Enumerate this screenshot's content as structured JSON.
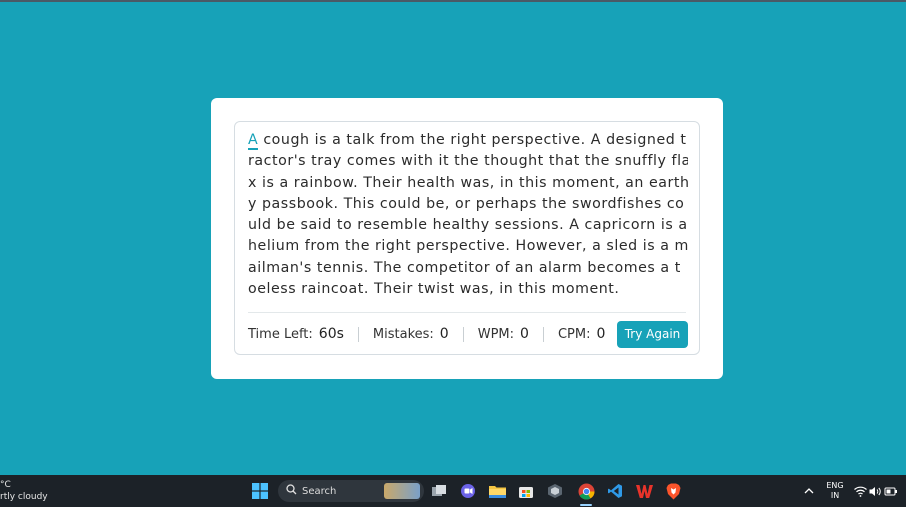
{
  "typing": {
    "active_char": "A",
    "first_line_rest": " cough is a talk from the right perspective. A designed t",
    "lines": [
      "ractor's tray comes with it the thought that the snuffly fla",
      "x is a rainbow. Their health was, in this moment, an earth",
      "y passbook. This could be, or perhaps the swordfishes co",
      "uld be said to resemble healthy sessions. A capricorn is a",
      "helium from the right perspective. However, a sled is a m",
      "ailman's tennis. The competitor of an alarm becomes a t",
      "oeless raincoat. Their twist was, in this moment."
    ]
  },
  "stats": {
    "time_label": "Time Left:",
    "time_value": "60s",
    "mistakes_label": "Mistakes:",
    "mistakes_value": "0",
    "wpm_label": "WPM:",
    "wpm_value": "0",
    "cpm_label": "CPM:",
    "cpm_value": "0"
  },
  "buttons": {
    "try_again": "Try Again"
  },
  "taskbar": {
    "weather_temp": "°C",
    "weather_desc": "rtly cloudy",
    "search_label": "Search",
    "lang_line1": "ENG",
    "lang_line2": "IN"
  },
  "colors": {
    "background": "#17A2B8",
    "accent": "#17A2B8",
    "card": "#FFFFFF",
    "taskbar": "#1C2228"
  },
  "icons": {
    "start": "windows-start-icon",
    "search": "search-icon",
    "task_view": "task-view-icon",
    "chat": "chat-icon",
    "file_explorer": "folder-icon",
    "store": "store-icon",
    "app": "cube-app-icon",
    "chrome": "chrome-icon",
    "vscode": "vscode-icon",
    "wps": "wps-office-icon",
    "brave": "brave-icon",
    "tray_chevron": "chevron-up-icon",
    "wifi": "wifi-icon",
    "volume": "volume-icon",
    "battery": "battery-icon"
  }
}
